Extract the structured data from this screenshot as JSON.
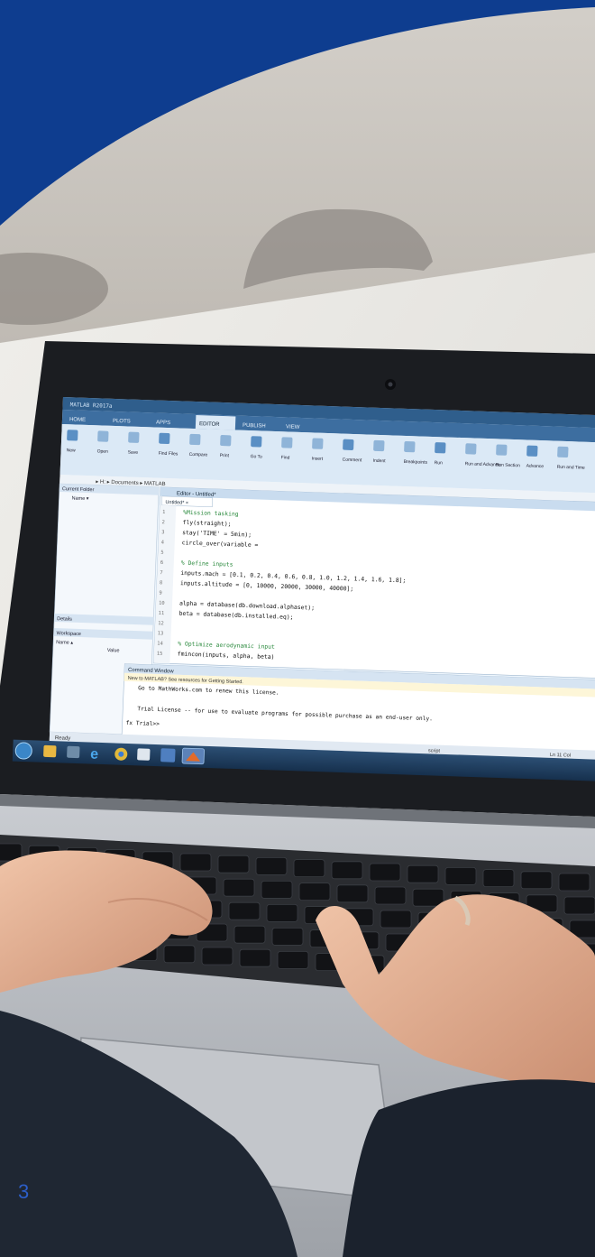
{
  "colors": {
    "brand_blue": "#0e3d8f",
    "wall": "#c8c3bc",
    "desk": "#e9e7e3",
    "laptop_silver": "#b9bcc1",
    "bezel": "#1b1d21",
    "screen_bg": "#eef6fd",
    "sleeve": "#1f2733",
    "skin": "#e7b296",
    "page_number": "#2c5ec8"
  },
  "matlab": {
    "tabs": [
      "HOME",
      "PLOTS",
      "APPS",
      "EDITOR",
      "PUBLISH",
      "VIEW"
    ],
    "active_tab": "EDITOR",
    "toolbar": [
      "New",
      "Open",
      "Save",
      "Find Files",
      "Compare",
      "Print",
      "Go To",
      "Find",
      "Insert",
      "Comment",
      "Indent",
      "Breakpoints",
      "Run",
      "Run and Advance",
      "Run Section",
      "Advance",
      "Run and Time"
    ],
    "path": "▸ H: ▸ Documents ▸ MATLAB",
    "left_panel": {
      "current_folder": "Current Folder",
      "name_col": "Name ▾",
      "details": "Details",
      "workspace": "Workspace",
      "ws_name": "Name ▴",
      "ws_value": "Value"
    },
    "editor_title": "Editor - Untitled*",
    "editor_tab": "Untitled* ×",
    "editor_lines": [
      "%Mission tasking",
      "fly(straight);",
      "stay('TIME' = 5min);",
      "circle_over(variable =",
      "",
      "% Define inputs",
      "inputs.mach = [0.1, 0.2, 0.4, 0.6, 0.8, 1.0, 1.2, 1.4, 1.6, 1.8];",
      "inputs.altitude = [0, 10000, 20000, 30000, 40000];",
      "",
      "alpha = database(db.download.alphaset);",
      "beta = database(db.installed.eq);",
      "",
      "",
      "% Optimize aerodynamic input",
      "fmincon(inputs, alpha, beta)"
    ],
    "command_window": {
      "title": "Command Window",
      "info": "New to MATLAB? See resources for Getting Started.",
      "line1": "Go to MathWorks.com to renew this license.",
      "line2": "Trial License -- for use to evaluate programs for possible purchase as an end-user only.",
      "prompt": "fx Trial>>"
    },
    "status": "Ready",
    "status_right": "script",
    "status_pos": "Ln 11    Col"
  },
  "page_number": "3"
}
